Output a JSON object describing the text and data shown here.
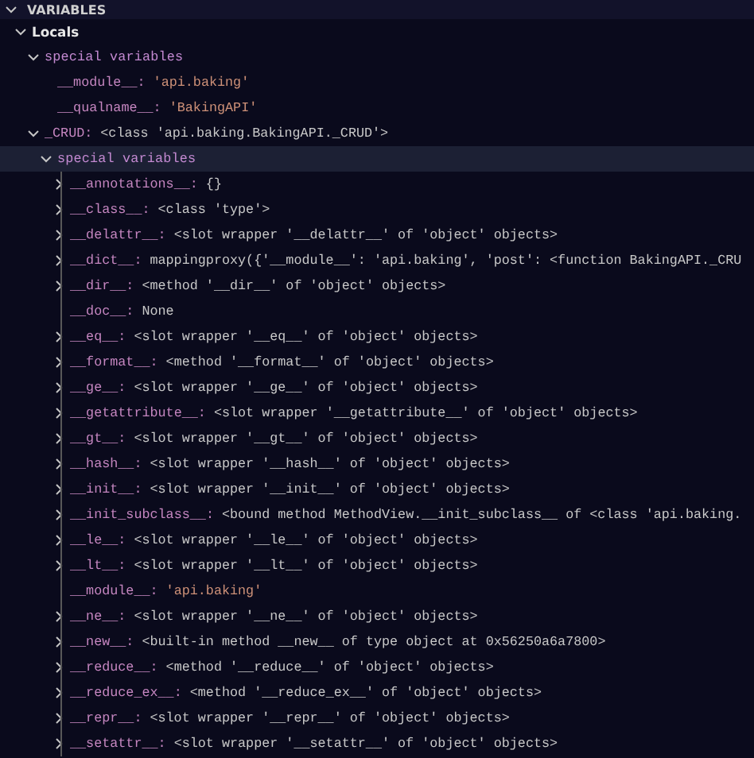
{
  "panel": {
    "title": "VARIABLES",
    "expanded": true
  },
  "tree": [
    {
      "kind": "scope",
      "name": "Locals",
      "expanded": true,
      "selected": false,
      "children": [
        {
          "kind": "group",
          "name": "special variables",
          "expanded": true,
          "selected": false,
          "children": [
            {
              "kind": "string",
              "name": "__module__:",
              "value": "'api.baking'",
              "selected": false
            },
            {
              "kind": "string",
              "name": "__qualname__:",
              "value": "'BakingAPI'",
              "selected": false
            }
          ]
        },
        {
          "kind": "object",
          "name": "_CRUD:",
          "value": "<class 'api.baking.BakingAPI._CRUD'>",
          "expanded": true,
          "selected": false,
          "children": [
            {
              "kind": "group",
              "name": "special variables",
              "expanded": true,
              "selected": true,
              "children": [
                {
                  "kind": "object",
                  "name": "__annotations__:",
                  "value": "{}",
                  "expanded": false,
                  "selected": false
                },
                {
                  "kind": "object",
                  "name": "__class__:",
                  "value": "<class 'type'>",
                  "expanded": false,
                  "selected": false
                },
                {
                  "kind": "object",
                  "name": "__delattr__:",
                  "value": "<slot wrapper '__delattr__' of 'object' objects>",
                  "expanded": false,
                  "selected": false
                },
                {
                  "kind": "object",
                  "name": "__dict__:",
                  "value": "mappingproxy({'__module__': 'api.baking', 'post': <function BakingAPI._CRU",
                  "expanded": false,
                  "selected": false
                },
                {
                  "kind": "object",
                  "name": "__dir__:",
                  "value": "<method '__dir__' of 'object' objects>",
                  "expanded": false,
                  "selected": false
                },
                {
                  "kind": "object",
                  "name": "__doc__:",
                  "value": "None",
                  "selected": false
                },
                {
                  "kind": "object",
                  "name": "__eq__:",
                  "value": "<slot wrapper '__eq__' of 'object' objects>",
                  "expanded": false,
                  "selected": false
                },
                {
                  "kind": "object",
                  "name": "__format__:",
                  "value": "<method '__format__' of 'object' objects>",
                  "expanded": false,
                  "selected": false
                },
                {
                  "kind": "object",
                  "name": "__ge__:",
                  "value": "<slot wrapper '__ge__' of 'object' objects>",
                  "expanded": false,
                  "selected": false
                },
                {
                  "kind": "object",
                  "name": "__getattribute__:",
                  "value": "<slot wrapper '__getattribute__' of 'object' objects>",
                  "expanded": false,
                  "selected": false
                },
                {
                  "kind": "object",
                  "name": "__gt__:",
                  "value": "<slot wrapper '__gt__' of 'object' objects>",
                  "expanded": false,
                  "selected": false
                },
                {
                  "kind": "object",
                  "name": "__hash__:",
                  "value": "<slot wrapper '__hash__' of 'object' objects>",
                  "expanded": false,
                  "selected": false
                },
                {
                  "kind": "object",
                  "name": "__init__:",
                  "value": "<slot wrapper '__init__' of 'object' objects>",
                  "expanded": false,
                  "selected": false
                },
                {
                  "kind": "object",
                  "name": "__init_subclass__:",
                  "value": "<bound method MethodView.__init_subclass__ of <class 'api.baking.",
                  "expanded": false,
                  "selected": false
                },
                {
                  "kind": "object",
                  "name": "__le__:",
                  "value": "<slot wrapper '__le__' of 'object' objects>",
                  "expanded": false,
                  "selected": false
                },
                {
                  "kind": "object",
                  "name": "__lt__:",
                  "value": "<slot wrapper '__lt__' of 'object' objects>",
                  "expanded": false,
                  "selected": false
                },
                {
                  "kind": "string",
                  "name": "__module__:",
                  "value": "'api.baking'",
                  "selected": false
                },
                {
                  "kind": "object",
                  "name": "__ne__:",
                  "value": "<slot wrapper '__ne__' of 'object' objects>",
                  "expanded": false,
                  "selected": false
                },
                {
                  "kind": "object",
                  "name": "__new__:",
                  "value": "<built-in method __new__ of type object at 0x56250a6a7800>",
                  "expanded": false,
                  "selected": false
                },
                {
                  "kind": "object",
                  "name": "__reduce__:",
                  "value": "<method '__reduce__' of 'object' objects>",
                  "expanded": false,
                  "selected": false
                },
                {
                  "kind": "object",
                  "name": "__reduce_ex__:",
                  "value": "<method '__reduce_ex__' of 'object' objects>",
                  "expanded": false,
                  "selected": false
                },
                {
                  "kind": "object",
                  "name": "__repr__:",
                  "value": "<slot wrapper '__repr__' of 'object' objects>",
                  "expanded": false,
                  "selected": false
                },
                {
                  "kind": "object",
                  "name": "__setattr__:",
                  "value": "<slot wrapper '__setattr__' of 'object' objects>",
                  "expanded": false,
                  "selected": false
                }
              ]
            }
          ]
        }
      ]
    }
  ]
}
